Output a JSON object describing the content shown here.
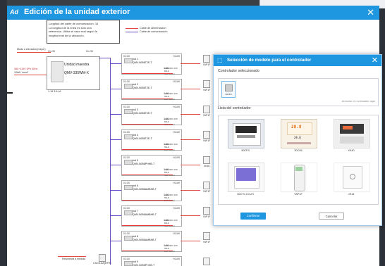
{
  "window": {
    "title": "Edición de la unidad exterior",
    "logo": "Ad",
    "close_icon": "close-icon"
  },
  "diagram": {
    "info_lines": [
      "Longitud del cable de comunicación: 16",
      "La longitud de la línea es solo una",
      "referencia. Utilice el valor real según la",
      "longitud real de la ubicación."
    ],
    "legend_power": "Cable de alimentación",
    "legend_comm": "Cable de comunicación",
    "master_hint": "Modo a elevación(mayor)",
    "odu_addr_left": "01-G0",
    "odu_addr_right": "01-G0",
    "odu_title": "Unidad maestra",
    "odu_model": "QMV-335WM-X",
    "odu_power": "380~415V 3Ph 50Hz",
    "odu_power2": "10kW, 4mm²",
    "odu_foot": "1-16 3-IU-A",
    "bottom_note": "Reconecta a medida",
    "bottom_ctrl": "CSGK-8A(RFR)",
    "indoor_units": [
      {
        "addr_l": "01-G0",
        "addr_r": "H1-M0",
        "name": "Ind 1",
        "model": "QMV-N056T2E-T",
        "power": "220-240V 1Ph 50Hz",
        "power2": "10A, 1mm²",
        "flow": "1-16",
        "ctrl": "YAP1F"
      },
      {
        "addr_l": "01-G0",
        "addr_r": "H1-M0",
        "name": "Ind 2",
        "model": "QMV-N056T2E-T",
        "power": "220-240V 1Ph 50Hz",
        "power2": "10A, 1mm²",
        "flow": "1-16",
        "ctrl": "YAP1F"
      },
      {
        "addr_l": "01-G0",
        "addr_r": "H1-M0",
        "name": "Ind 3",
        "model": "QMV-N056T2E-T",
        "power": "220-240V 1Ph 50Hz",
        "power2": "10A, 1mm²",
        "flow": "1-16",
        "ctrl": "YAP1F"
      },
      {
        "addr_l": "01-G0",
        "addr_r": "H1-M0",
        "name": "Ind 4",
        "model": "QMV-N056T2E-T",
        "power": "220-240V 1Ph 50Hz",
        "power2": "10A, 1mm²",
        "flow": "1-16",
        "ctrl": "YAP1F"
      },
      {
        "addr_l": "01-G0",
        "addr_r": "H1-M0",
        "name": "Ind 5",
        "model": "QMV-N056PHHB-T",
        "power": "220-240V 1Ph 50Hz",
        "power2": "10A, 1mm²",
        "flow": "1-16",
        "ctrl": "XK46"
      },
      {
        "addr_l": "01-G0",
        "addr_r": "H1-M0",
        "name": "Ind 6",
        "model": "QMV-N056AMBHB-T",
        "power": "220-240V 1Ph 50Hz",
        "power2": "10A, 1mm²",
        "flow": "1-16",
        "ctrl": "YAP1F"
      },
      {
        "addr_l": "01-G0",
        "addr_r": "H1-M0",
        "name": "Ind 7",
        "model": "QMV-N056AMBHB-T",
        "power": "220-240V 1Ph 50Hz",
        "power2": "10A, 1mm²",
        "flow": "1-16",
        "ctrl": "YAP1F"
      },
      {
        "addr_l": "01-G0",
        "addr_r": "H1-M0",
        "name": "Ind 8",
        "model": "QMV-N056AMBHB-T",
        "power": "220-240V 1Ph 50Hz",
        "power2": "10A, 1mm²",
        "flow": "1-16",
        "ctrl": "YAP1F"
      },
      {
        "addr_l": "01-G0",
        "addr_r": "H1-M0",
        "name": "Ind 9",
        "model": "QMV-N056PHHB-T",
        "power": "220-240V 1Ph 50Hz",
        "power2": "10A, 1mm²",
        "flow": "1-16",
        "ctrl": "XK46"
      }
    ]
  },
  "dialog": {
    "title": "Selección de modelo para el controlador",
    "selected_label": "Controlador seleccionado",
    "selected_item": "30CFS",
    "drop_hint": "Arrastrar el controlador aquí",
    "list_label": "Lista del controlador",
    "controllers": [
      "30CFS",
      "30C55",
      "XK40",
      "30C70-CCUH",
      "YAP1F",
      "JS13"
    ],
    "lcd_30c55": "28.8",
    "lcd_30c55_sub": "24.0",
    "confirm_label": "Confirmar",
    "cancel_label": "Cancelar"
  },
  "colors": {
    "accent": "#1f97e0",
    "power_line": "#e24848",
    "comm_line": "#6a4bbf"
  }
}
